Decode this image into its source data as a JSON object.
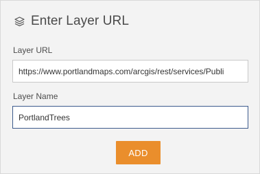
{
  "header": {
    "icon": "layers-icon",
    "title": "Enter Layer URL"
  },
  "form": {
    "url_label": "Layer URL",
    "url_value": "https://www.portlandmaps.com/arcgis/rest/services/Publi",
    "name_label": "Layer Name",
    "name_value": "PortlandTrees",
    "add_label": "ADD"
  },
  "colors": {
    "accent": "#ea8e2c",
    "panel_bg": "#f3f3f3",
    "focus_border": "#3c5a8c"
  }
}
